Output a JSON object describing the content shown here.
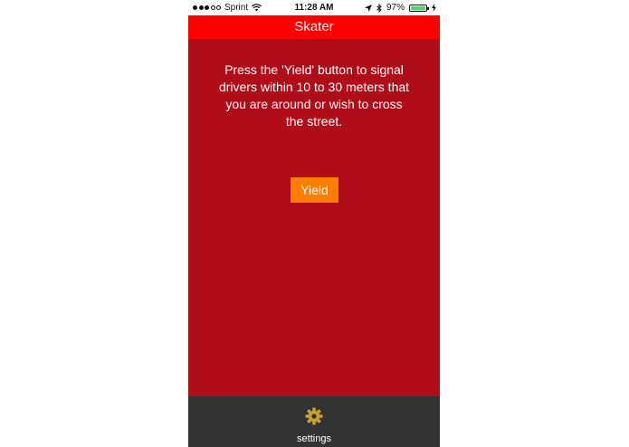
{
  "status_bar": {
    "carrier": "Sprint",
    "time": "11:28 AM",
    "battery_percent": "97%",
    "battery_level": 0.97,
    "signal_bars_filled": 3,
    "signal_bars_total": 5,
    "icons": [
      "signal-dots-icon",
      "wifi-icon",
      "location-arrow-icon",
      "bluetooth-icon",
      "battery-icon",
      "charging-bolt-icon"
    ]
  },
  "nav_bar": {
    "title": "Skater"
  },
  "main": {
    "message": "Press the 'Yield' button to signal drivers within 10 to 30 meters that you are around or wish to cross the street.",
    "yield_button_label": "Yield"
  },
  "tab_bar": {
    "items": [
      {
        "label": "settings",
        "icon": "gear-icon"
      }
    ]
  },
  "colors": {
    "background": "#b00d1b",
    "nav_bar": "#fd0000",
    "button": "#fc7e00",
    "tab_bar": "#333333",
    "gear": "#c8a032",
    "battery": "#4cd964"
  }
}
